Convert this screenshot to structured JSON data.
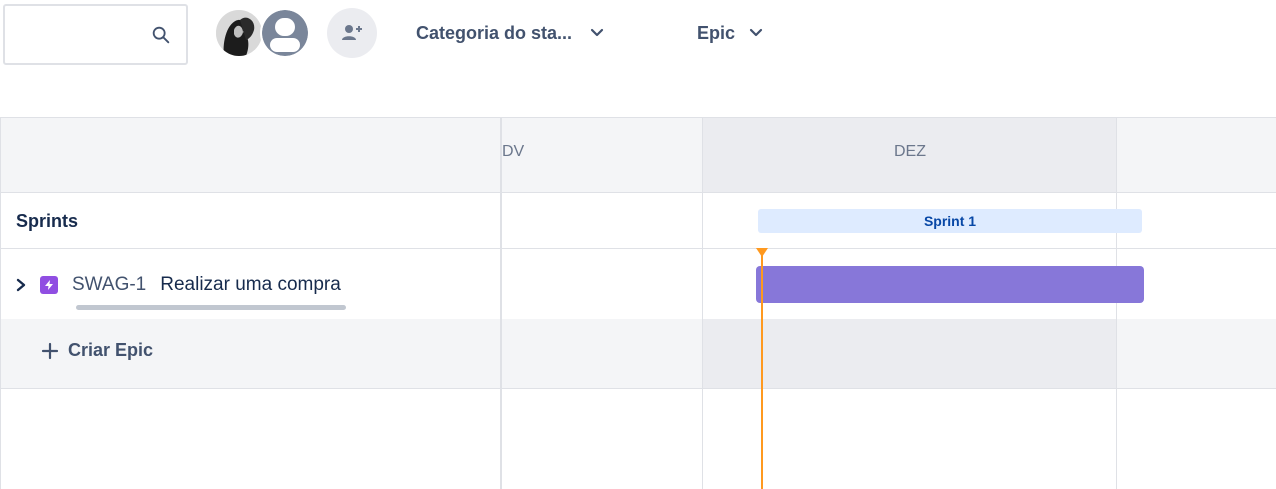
{
  "toolbar": {
    "search": {
      "placeholder": "",
      "value": "",
      "icon": "search-icon"
    },
    "avatars": [
      {
        "kind": "photo",
        "icon": "user-photo-avatar"
      },
      {
        "kind": "default",
        "icon": "default-user-avatar"
      }
    ],
    "add_people_icon": "add-person-icon",
    "filters": [
      {
        "label": "Categoria do sta...",
        "icon": "chevron-down-icon"
      },
      {
        "label": "Epic",
        "icon": "chevron-down-icon"
      }
    ]
  },
  "timeline": {
    "months": [
      "DV",
      "DEZ"
    ],
    "sprints_label": "Sprints",
    "sprints": [
      {
        "name": "Sprint 1"
      }
    ],
    "epics": [
      {
        "key": "SWAG-1",
        "title": "Realizar uma compra",
        "icon": "epic-lightning-icon"
      }
    ],
    "create_epic_label": "Criar Epic"
  },
  "colors": {
    "accent": "#0052cc",
    "epic_bar": "#8777d9",
    "epic_icon": "#904ee2",
    "sprint_bar": "#deebff",
    "today_line": "#ff991f",
    "header_band": "#f4f5f7"
  }
}
